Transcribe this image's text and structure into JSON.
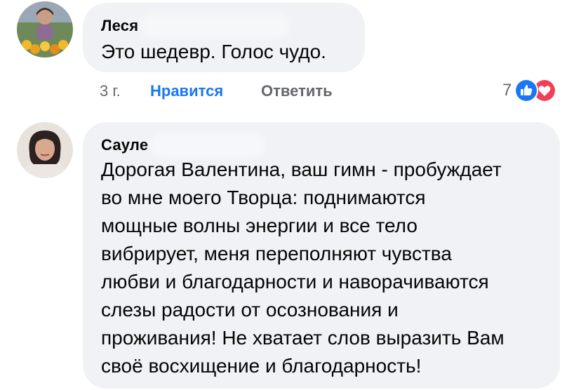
{
  "comments": [
    {
      "author": "Леся",
      "text": "Это шедевр. Голос чудо.",
      "time": "3 г.",
      "like_label": "Нравится",
      "reply_label": "Ответить",
      "reaction_count": "7",
      "reaction_icons": [
        "like-icon",
        "love-icon"
      ]
    },
    {
      "author": "Сауле",
      "text_lines": [
        "Дорогая Валентина, ваш гимн - пробуждает",
        "во мне моего Творца: поднимаются",
        "мощные волны энергии и все тело",
        "вибрирует, меня переполняют чувства",
        "любви и благодарности и наворачиваются",
        "слезы радости от осознования и",
        "проживания! Не хватает слов выразить Вам",
        "своё восхищение и благодарность!"
      ]
    }
  ],
  "colors": {
    "bubble": "#f0f2f5",
    "like_blue": "#1877f2",
    "love_red": "#f33e58",
    "meta_gray": "#65676b"
  }
}
